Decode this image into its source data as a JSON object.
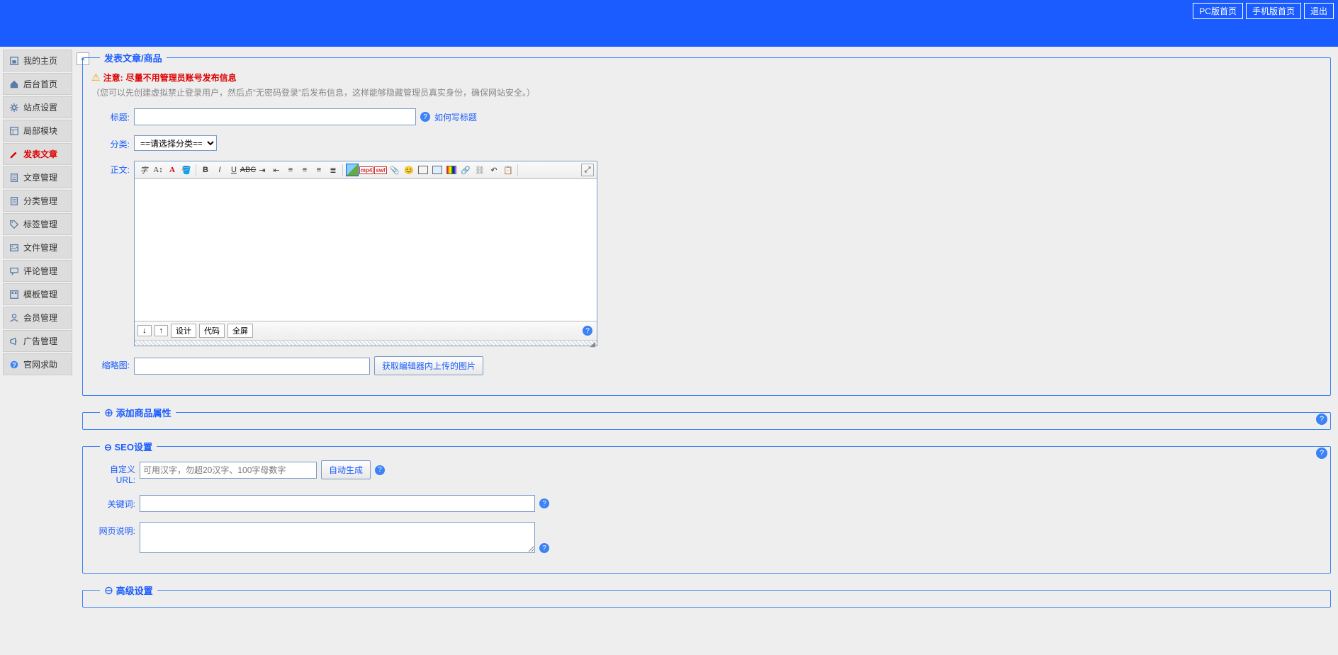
{
  "header": {
    "buttons": {
      "pc": "PC版首页",
      "mobile": "手机版首页",
      "logout": "退出"
    }
  },
  "sidebar": {
    "items": [
      {
        "label": "我的主页",
        "icon": "home-box"
      },
      {
        "label": "后台首页",
        "icon": "home"
      },
      {
        "label": "站点设置",
        "icon": "gear"
      },
      {
        "label": "局部模块",
        "icon": "layout"
      },
      {
        "label": "发表文章",
        "icon": "write",
        "active": true
      },
      {
        "label": "文章管理",
        "icon": "doc"
      },
      {
        "label": "分类管理",
        "icon": "doc"
      },
      {
        "label": "标签管理",
        "icon": "tag"
      },
      {
        "label": "文件管理",
        "icon": "image"
      },
      {
        "label": "评论管理",
        "icon": "comment"
      },
      {
        "label": "模板管理",
        "icon": "template"
      },
      {
        "label": "会员管理",
        "icon": "user"
      },
      {
        "label": "广告管理",
        "icon": "megaphone"
      },
      {
        "label": "官网求助",
        "icon": "help"
      }
    ]
  },
  "page": {
    "title": "发表文章/商品",
    "warning_label": "注意:",
    "warning_text": "尽量不用管理员账号发布信息",
    "warning_sub": "（您可以先创建虚拟禁止登录用户，然后点“无密码登录”后发布信息，这样能够隐藏管理员真实身份，确保网站安全。）"
  },
  "form": {
    "title_label": "标题:",
    "title_help_link": "如何写标题",
    "category_label": "分类:",
    "category_placeholder": "==请选择分类==",
    "body_label": "正文:",
    "thumb_label": "缩略图:",
    "thumb_btn": "获取编辑器内上传的图片"
  },
  "editor_footer": {
    "arrow_down": "↓",
    "arrow_up": "↑",
    "design": "设计",
    "code": "代码",
    "full": "全屏"
  },
  "sections": {
    "product": "添加商品属性",
    "seo": "SEO设置",
    "advanced": "高级设置"
  },
  "seo": {
    "url_label": "自定义URL:",
    "url_placeholder": "可用汉字，勿超20汉字、100字母数字",
    "url_auto_btn": "自动生成",
    "kw_label": "关键词:",
    "desc_label": "网页说明:"
  }
}
